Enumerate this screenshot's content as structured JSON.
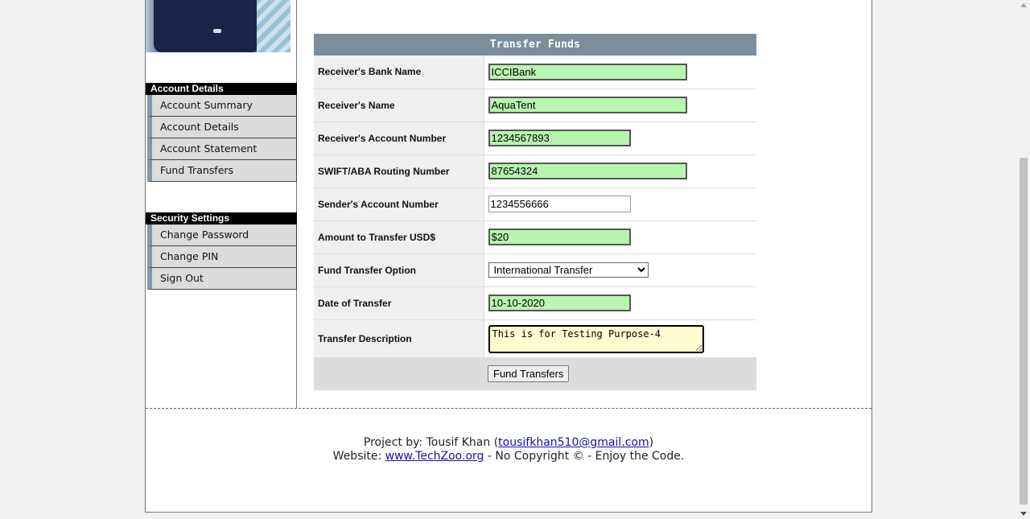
{
  "sidebar": {
    "account_title": "Account Details",
    "account_items": [
      "Account Summary",
      "Account Details",
      "Account Statement",
      "Fund Transfers"
    ],
    "security_title": "Security Settings",
    "security_items": [
      "Change Password",
      "Change PIN",
      "Sign Out"
    ]
  },
  "form": {
    "title": "Transfer Funds",
    "bank_name_label": "Receiver's Bank Name",
    "bank_name_value": "ICCIBank",
    "receiver_name_label": "Receiver's Name",
    "receiver_name_value": "AquaTent",
    "receiver_account_label": "Receiver's Account Number",
    "receiver_account_value": "1234567893",
    "routing_label": "SWIFT/ABA Routing Number",
    "routing_value": "87654324",
    "sender_account_label": "Sender's Account Number",
    "sender_account_value": "1234556666",
    "amount_label": "Amount to Transfer USD$",
    "amount_value": "$20",
    "option_label": "Fund Transfer Option",
    "option_value": "International Transfer",
    "date_label": "Date of Transfer",
    "date_value": "10-10-2020",
    "description_label": "Transfer Description",
    "description_value": "This is for Testing Purpose-4",
    "submit_label": "Fund Transfers"
  },
  "footer": {
    "project_prefix": "Project by: Tousif Khan (",
    "email": "tousifkhan510@gmail.com",
    "project_suffix": ")",
    "website_prefix": "Website: ",
    "website": "www.TechZoo.org",
    "website_suffix": " - No Copyright © - Enjoy the Code."
  },
  "colors": {
    "filled_field": "#b8f5b0",
    "header_bar": "#7d8d9b",
    "menu_accent": "#8497a6"
  }
}
